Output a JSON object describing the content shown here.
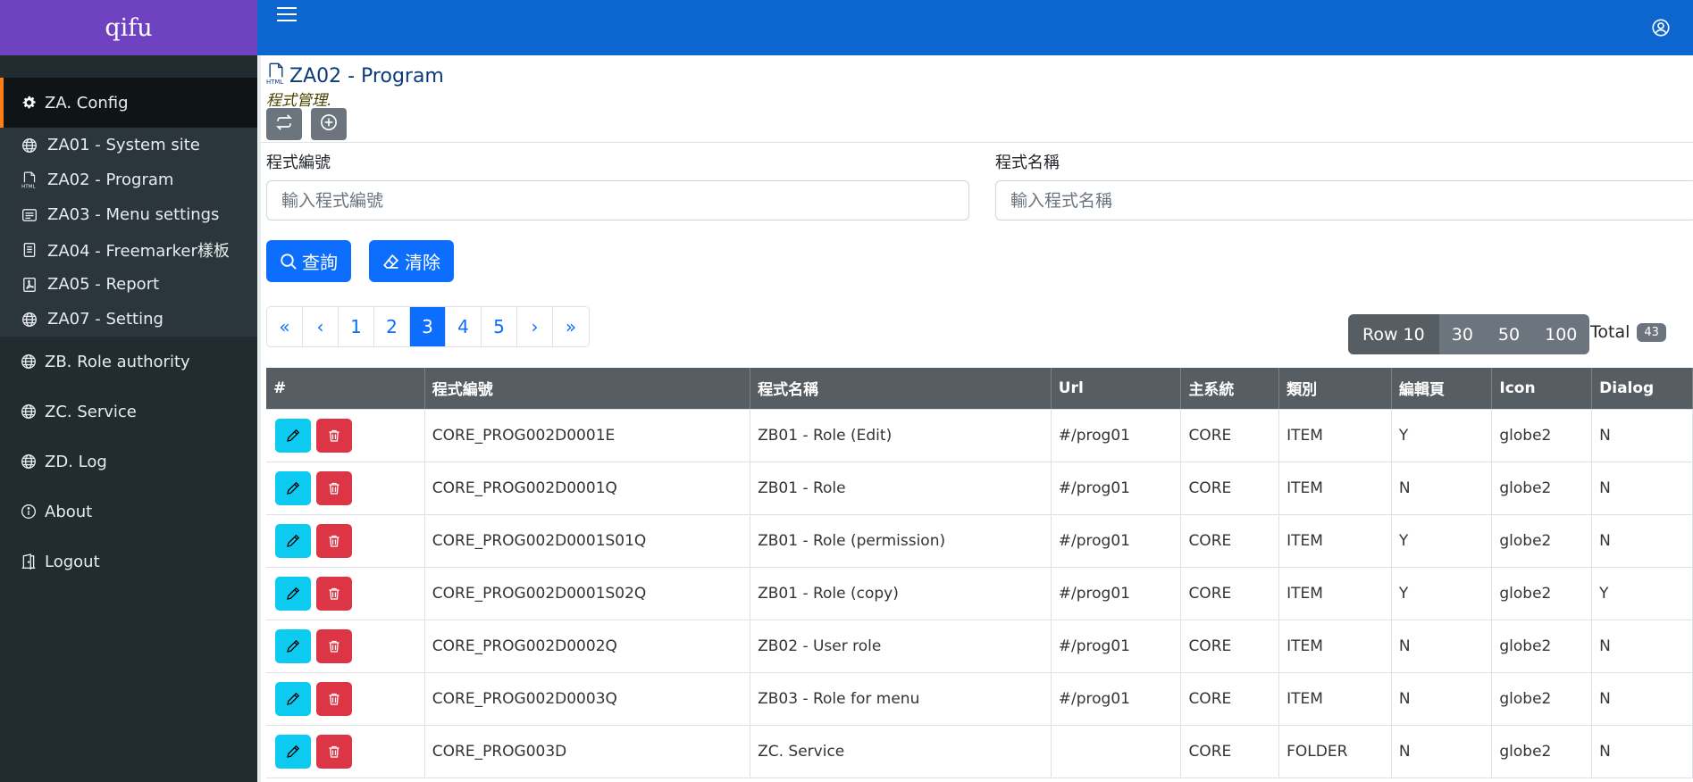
{
  "brand": "qifu",
  "menu": {
    "config": "ZA. Config",
    "sub": [
      {
        "label": "ZA01 - System site",
        "icon": "globe-icon"
      },
      {
        "label": "ZA02 - Program",
        "icon": "html-file-icon"
      },
      {
        "label": "ZA03 - Menu settings",
        "icon": "menu-card-icon"
      },
      {
        "label": "ZA04 - Freemarker樣板",
        "icon": "document-icon"
      },
      {
        "label": "ZA05 - Report",
        "icon": "pdf-file-icon"
      },
      {
        "label": "ZA07 - Setting",
        "icon": "globe-icon"
      }
    ],
    "role": "ZB. Role authority",
    "service": "ZC. Service",
    "log": "ZD. Log",
    "about": "About",
    "logout": "Logout"
  },
  "page": {
    "title": "ZA02 - Program",
    "subtitle": "程式管理."
  },
  "form": {
    "prog_id_label": "程式編號",
    "prog_id_placeholder": "輸入程式編號",
    "prog_name_label": "程式名稱",
    "prog_name_placeholder": "輸入程式名稱",
    "query": "查詢",
    "clear": "清除"
  },
  "pagination": {
    "first": "«",
    "prev": "‹",
    "pages": [
      "1",
      "2",
      "3",
      "4",
      "5"
    ],
    "current": "3",
    "next": "›",
    "last": "»"
  },
  "rowsize": {
    "options": [
      "Row 10",
      "30",
      "50",
      "100"
    ],
    "selected": "Row 10"
  },
  "total": {
    "label": "Total",
    "count": "43"
  },
  "table": {
    "headers": [
      "#",
      "程式編號",
      "程式名稱",
      "Url",
      "主系統",
      "類別",
      "編輯頁",
      "Icon",
      "Dialog"
    ],
    "rows": [
      [
        "CORE_PROG002D0001E",
        "ZB01 - Role (Edit)",
        "#/prog01",
        "CORE",
        "ITEM",
        "Y",
        "globe2",
        "N"
      ],
      [
        "CORE_PROG002D0001Q",
        "ZB01 - Role",
        "#/prog01",
        "CORE",
        "ITEM",
        "N",
        "globe2",
        "N"
      ],
      [
        "CORE_PROG002D0001S01Q",
        "ZB01 - Role (permission)",
        "#/prog01",
        "CORE",
        "ITEM",
        "Y",
        "globe2",
        "N"
      ],
      [
        "CORE_PROG002D0001S02Q",
        "ZB01 - Role (copy)",
        "#/prog01",
        "CORE",
        "ITEM",
        "Y",
        "globe2",
        "Y"
      ],
      [
        "CORE_PROG002D0002Q",
        "ZB02 - User role",
        "#/prog01",
        "CORE",
        "ITEM",
        "N",
        "globe2",
        "N"
      ],
      [
        "CORE_PROG002D0003Q",
        "ZB03 - Role for menu",
        "#/prog01",
        "CORE",
        "ITEM",
        "N",
        "globe2",
        "N"
      ],
      [
        "CORE_PROG003D",
        "ZC. Service",
        "",
        "CORE",
        "FOLDER",
        "N",
        "globe2",
        "N"
      ]
    ]
  },
  "colors": {
    "sidebar": "#212b30",
    "brand": "#6f42c1",
    "topbar": "#0d66d0",
    "primary": "#0d6efd",
    "info": "#0dcaf0",
    "danger": "#dc3545",
    "accent": "#fd7e14"
  }
}
